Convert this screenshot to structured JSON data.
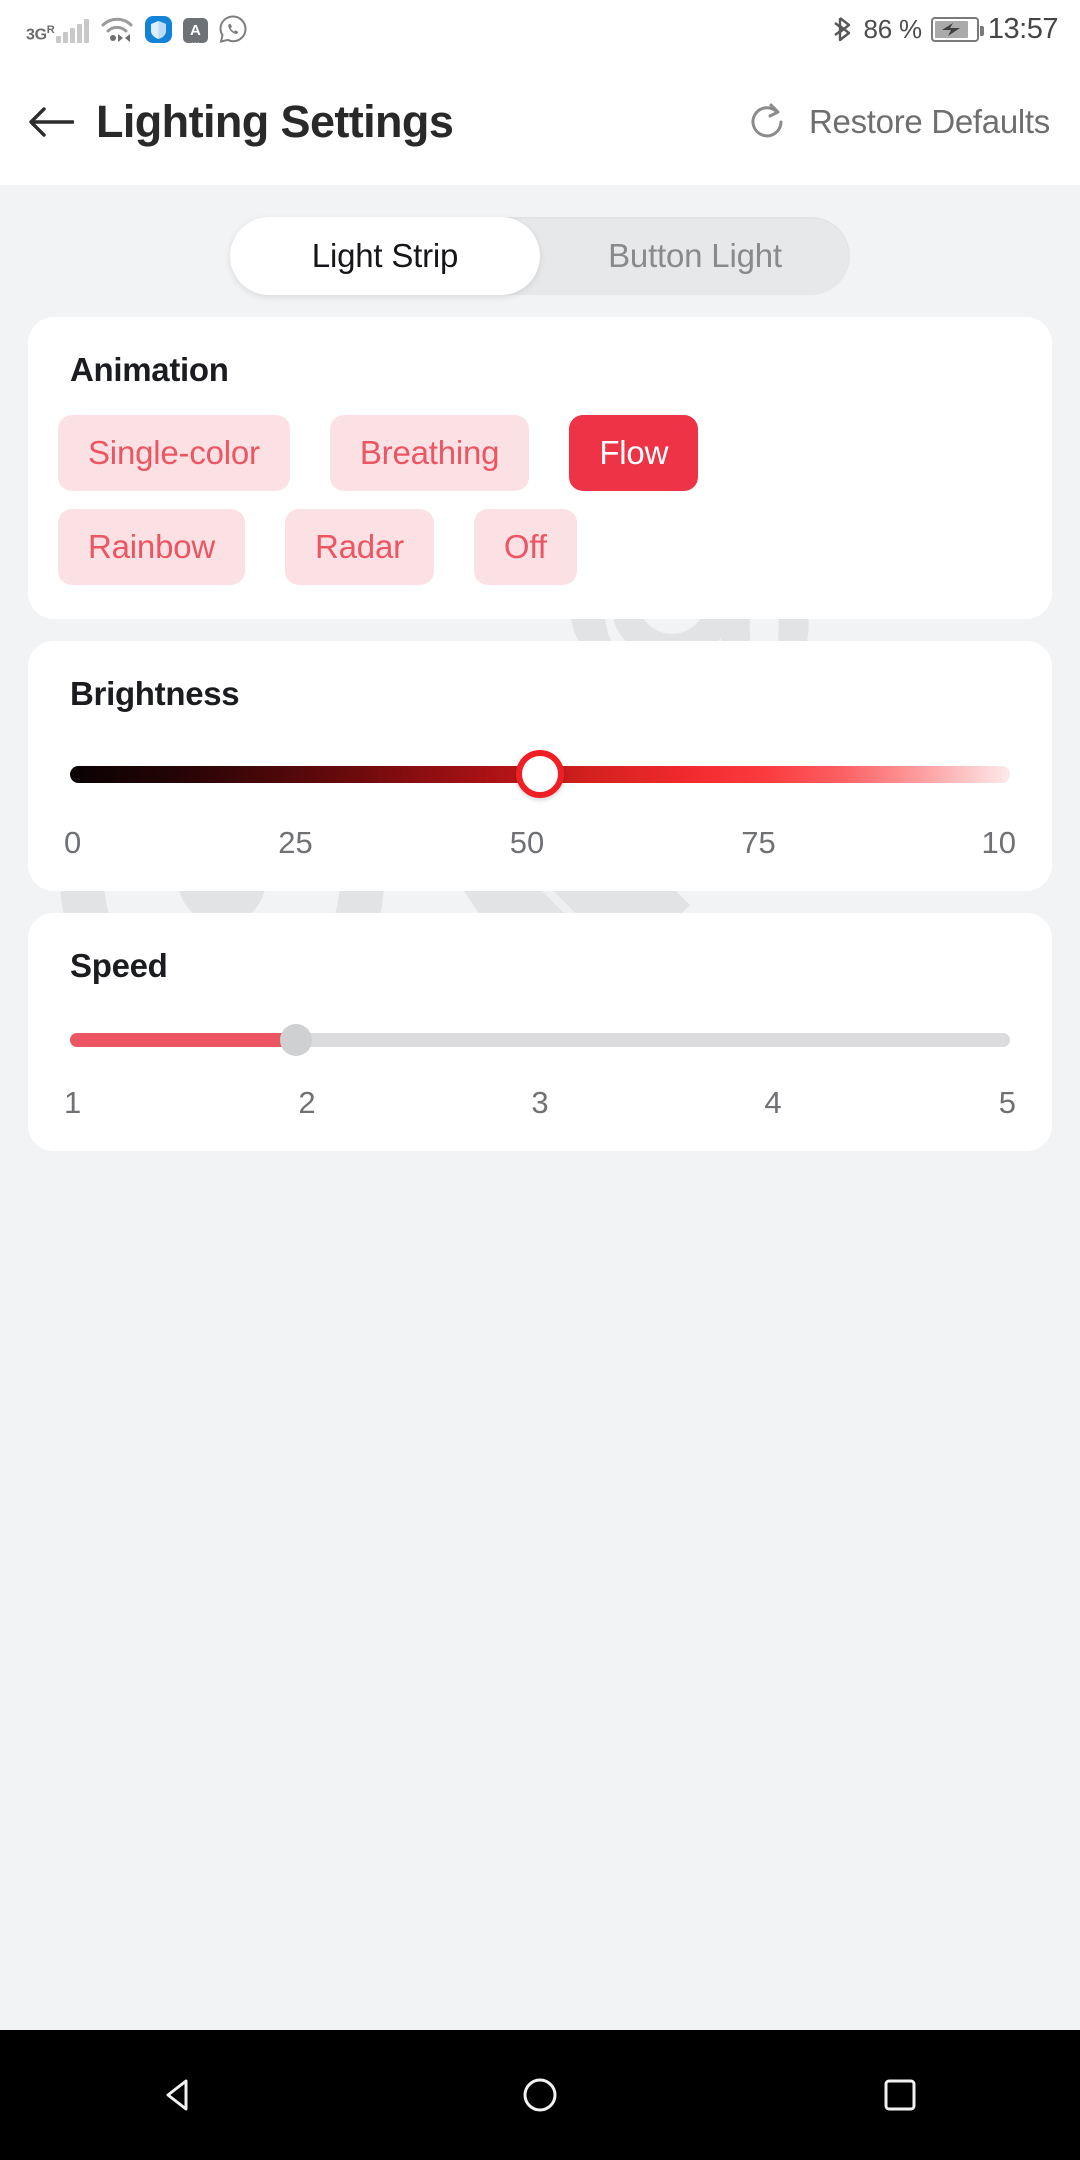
{
  "statusbar": {
    "network_type": "3G",
    "roaming": "R",
    "signal_icon": "signal-bars-icon",
    "wifi_icon": "wifi-icon",
    "shield_app_icon": "shield-app-icon",
    "keyboard_app_icon": "keyboard-a-icon",
    "whatsapp_icon": "whatsapp-icon",
    "bluetooth_icon": "bluetooth-icon",
    "battery_percent": "86 %",
    "battery_icon": "battery-charging-icon",
    "clock": "13:57"
  },
  "header": {
    "back_icon": "back-arrow-icon",
    "title": "Lighting Settings",
    "restore_icon": "restore-refresh-icon",
    "restore_label": "Restore Defaults"
  },
  "segmented": {
    "tabs": [
      {
        "label": "Light Strip",
        "selected": true
      },
      {
        "label": "Button Light",
        "selected": false
      }
    ]
  },
  "animation": {
    "title": "Animation",
    "options": [
      {
        "label": "Single-color",
        "selected": false
      },
      {
        "label": "Breathing",
        "selected": false
      },
      {
        "label": "Flow",
        "selected": true
      },
      {
        "label": "Rainbow",
        "selected": false
      },
      {
        "label": "Radar",
        "selected": false
      },
      {
        "label": "Off",
        "selected": false
      }
    ]
  },
  "brightness": {
    "title": "Brightness",
    "value": 50,
    "min": 0,
    "max": 100,
    "ticks": [
      "0",
      "25",
      "50",
      "75",
      "10"
    ]
  },
  "speed": {
    "title": "Speed",
    "value": 2,
    "min": 1,
    "max": 5,
    "ticks": [
      "1",
      "2",
      "3",
      "4",
      "5"
    ]
  },
  "navbar": {
    "back_icon": "nav-back-triangle-icon",
    "home_icon": "nav-home-circle-icon",
    "recents_icon": "nav-recents-square-icon"
  },
  "colors": {
    "accent": "#ee3347",
    "chip_bg": "#fce1e4",
    "chip_text": "#ec5663",
    "page_bg": "#f2f3f5",
    "card_bg": "#ffffff"
  },
  "watermark": {
    "text": "H&Co"
  }
}
